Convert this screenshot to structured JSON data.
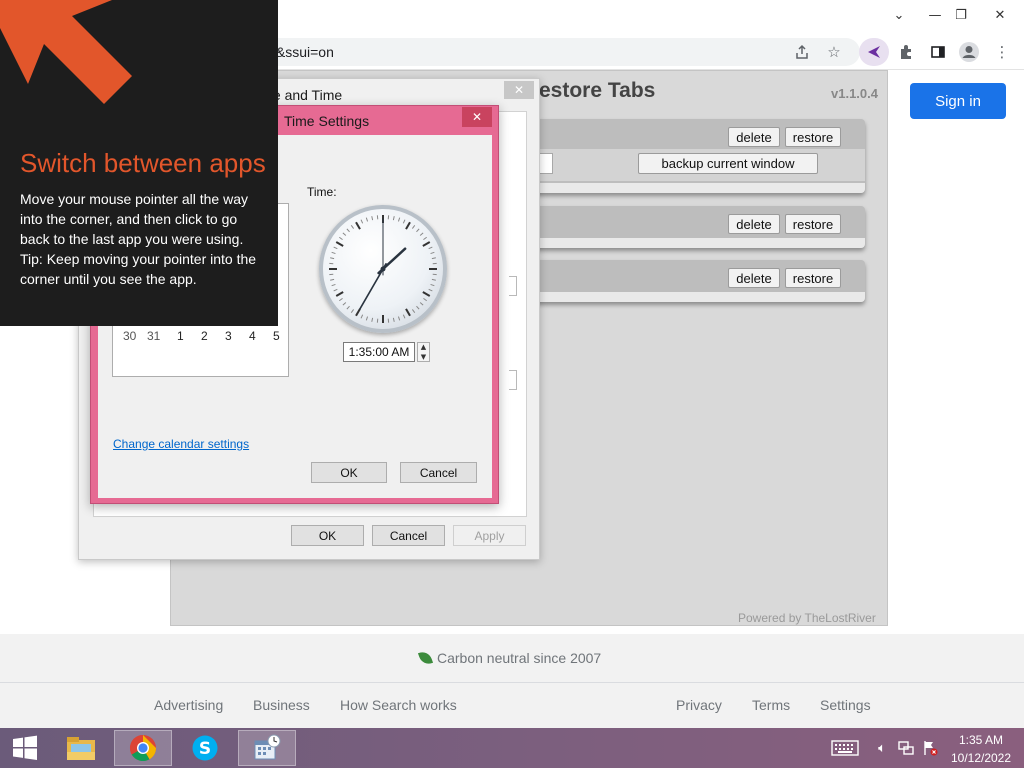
{
  "browser": {
    "url_fragment": "ive&ssui=on",
    "window_controls": {
      "minimize": "—",
      "restore": "❐",
      "close": "✕",
      "tab_menu": "⌄"
    },
    "toolbar_icons": [
      "share-icon",
      "bookmark-star-icon",
      "extension-arrow-icon",
      "puzzle-extensions-icon",
      "side-panel-icon",
      "profile-icon",
      "kebab-menu-icon"
    ]
  },
  "page": {
    "signin_label": "Sign in",
    "accent": "#1a73e8",
    "footer": {
      "carbon": "Carbon neutral since 2007",
      "links_left": [
        "Advertising",
        "Business",
        "How Search works"
      ],
      "links_right": [
        "Privacy",
        "Terms",
        "Settings"
      ]
    }
  },
  "extension": {
    "title": "estore Tabs",
    "version": "v1.1.0.4",
    "powered_by": "Powered by TheLostRiver",
    "delete_label": "delete",
    "restore_label": "restore",
    "backup_label": "backup current window"
  },
  "date_time_dialog": {
    "title": "te and Time",
    "ok": "OK",
    "cancel": "Cancel",
    "apply": "Apply"
  },
  "time_settings_dialog": {
    "title": "Time Settings",
    "time_label": "Time:",
    "time_value": "1:35:00 AM",
    "calendar_row": [
      "30",
      "31",
      "1",
      "2",
      "3",
      "4",
      "5"
    ],
    "change_calendar": "Change calendar settings",
    "ok": "OK",
    "cancel": "Cancel",
    "clock": {
      "hour": 1,
      "minute": 35,
      "second": 0
    },
    "frame_color": "#e66a93"
  },
  "charm_tip": {
    "title": "Switch between apps",
    "line1": "Move your mouse pointer all the way into the corner, and then click to go back to the last app you were using.",
    "line2": "Tip: Keep moving your pointer into the corner until you see the app.",
    "accent": "#e2562b"
  },
  "taskbar": {
    "apps": [
      "start-icon",
      "file-explorer-icon",
      "chrome-icon",
      "skype-icon",
      "date-time-control-panel-icon"
    ],
    "tray": [
      "keyboard-icon",
      "volume-icon",
      "network-icon",
      "action-center-flag-icon"
    ],
    "time": "1:35 AM",
    "date": "10/12/2022"
  }
}
